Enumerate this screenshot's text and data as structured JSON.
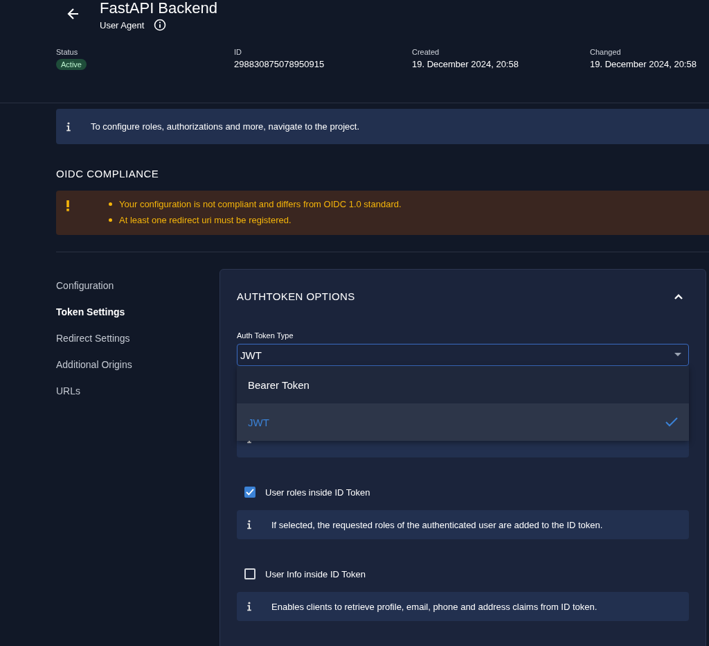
{
  "header": {
    "title": "FastAPI Backend",
    "subtitle": "User Agent"
  },
  "details": [
    {
      "label": "Status",
      "value": "Active",
      "kind": "badge"
    },
    {
      "label": "ID",
      "value": "298830875078950915",
      "kind": "text"
    },
    {
      "label": "Created",
      "value": "19. December 2024, 20:58",
      "kind": "text"
    },
    {
      "label": "Changed",
      "value": "19. December 2024, 20:58",
      "kind": "text"
    }
  ],
  "info_banner": "To configure roles, authorizations and more, navigate to the project.",
  "compliance": {
    "heading": "OIDC COMPLIANCE",
    "warnings": [
      "Your configuration is not compliant and differs from OIDC 1.0 standard.",
      "At least one redirect uri must be registered."
    ]
  },
  "nav": [
    {
      "label": "Configuration",
      "selected": false
    },
    {
      "label": "Token Settings",
      "selected": true
    },
    {
      "label": "Redirect Settings",
      "selected": false
    },
    {
      "label": "Additional Origins",
      "selected": false
    },
    {
      "label": "URLs",
      "selected": false
    }
  ],
  "card": {
    "title": "AUTHTOKEN OPTIONS",
    "expanded": true,
    "select": {
      "label": "Auth Token Type",
      "value": "JWT",
      "options": [
        {
          "label": "Bearer Token",
          "selected": false
        },
        {
          "label": "JWT",
          "selected": true
        }
      ]
    },
    "options": [
      {
        "label": "User roles inside ID Token",
        "checked": true,
        "hint": "If selected, the requested roles of the authenticated user are added to the ID token."
      },
      {
        "label": "User Info inside ID Token",
        "checked": false,
        "hint": "Enables clients to retrieve profile, email, phone and address claims from ID token."
      }
    ]
  }
}
